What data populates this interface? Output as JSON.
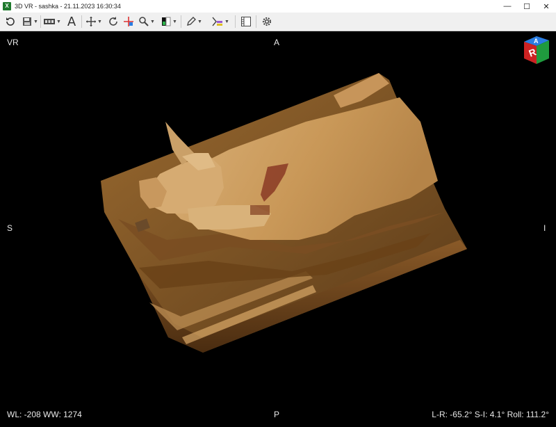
{
  "window": {
    "title": "3D VR - sashka - 21.11.2023 16:30:34",
    "app_icon_letter": "X",
    "minimize": "—",
    "maximize": "☐",
    "close": "✕"
  },
  "toolbar": {
    "text_tool_label": "A"
  },
  "orientation": {
    "top_left": "VR",
    "top": "A",
    "left": "S",
    "right": "I",
    "bottom": "P"
  },
  "window_level": "WL: -208 WW: 1274",
  "rotation_readout": "L-R: -65.2° S-I: 4.1° Roll: 111.2°",
  "cube": {
    "front_letter": "R",
    "top_letter": "A"
  }
}
